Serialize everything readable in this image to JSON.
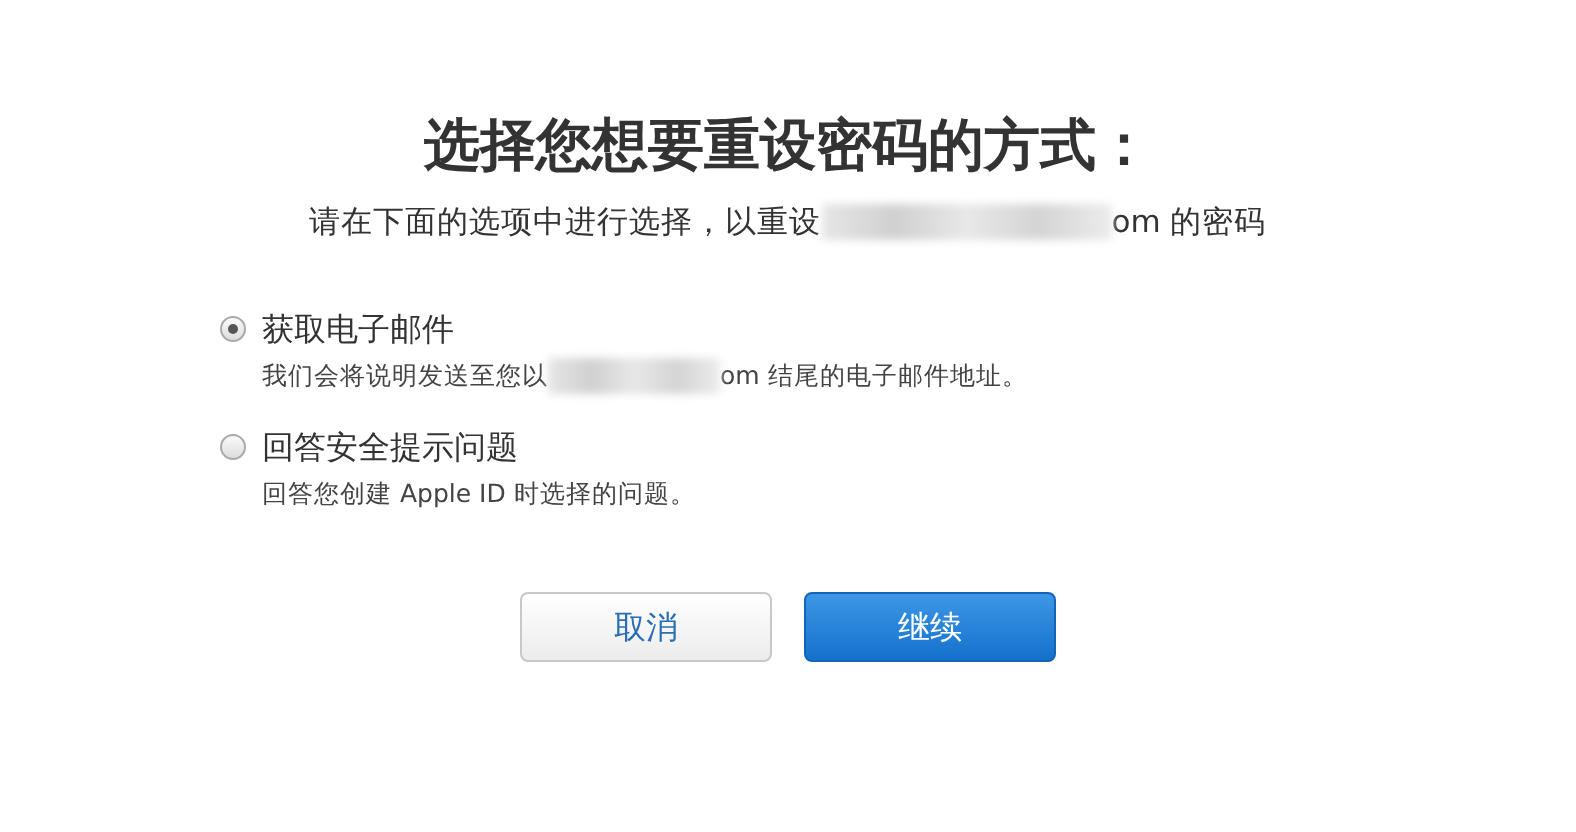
{
  "title": "选择您想要重设密码的方式：",
  "subtitle": {
    "before": "请在下面的选项中进行选择，以重设",
    "after": "om 的密码"
  },
  "options": [
    {
      "label": "获取电子邮件",
      "selected": true,
      "description": {
        "before": "我们会将说明发送至您以",
        "after": "om 结尾的电子邮件地址。"
      }
    },
    {
      "label": "回答安全提示问题",
      "selected": false,
      "description": {
        "before": "回答您创建 Apple ID 时选择的问题。"
      }
    }
  ],
  "buttons": [
    {
      "label": "取消",
      "kind": "secondary"
    },
    {
      "label": "继续",
      "kind": "primary"
    }
  ]
}
